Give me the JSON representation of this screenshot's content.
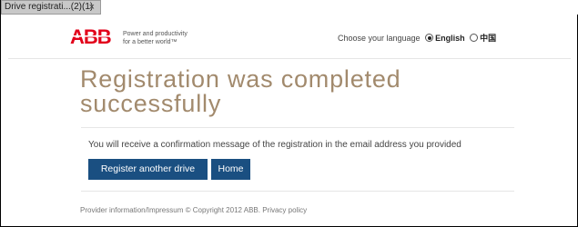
{
  "tab": {
    "title": "Drive registrati...(2)(1)",
    "close_glyph": "×"
  },
  "header": {
    "logo_text": "ABB",
    "tagline_line1": "Power and productivity",
    "tagline_line2": "for a better world™",
    "language_prompt": "Choose your language",
    "languages": [
      {
        "label": "English",
        "selected": true
      },
      {
        "label": "中国",
        "selected": false
      }
    ]
  },
  "main": {
    "title_line1": "Registration was completed",
    "title_line2": "successfully",
    "message": "You will receive a confirmation message of the registration in the email address you provided",
    "register_button": "Register another drive",
    "home_button": "Home"
  },
  "footer": {
    "text": "Provider information/Impressum © Copyright 2012 ABB. Privacy policy"
  },
  "colors": {
    "brand_red": "#e2001a",
    "title": "#a28a6d",
    "button": "#1a4f81"
  }
}
